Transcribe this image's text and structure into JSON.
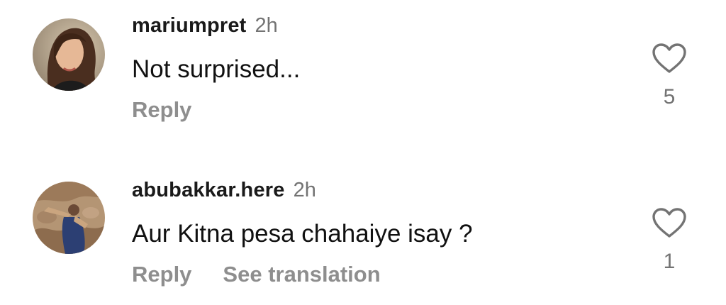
{
  "comments": [
    {
      "username": "mariumpret",
      "time": "2h",
      "text": "Not surprised...",
      "actions": [
        "Reply"
      ],
      "likes": "5",
      "avatar": "profile-photo-woman",
      "like_icon": "heart-outline-icon"
    },
    {
      "username": "abubakkar.here",
      "time": "2h",
      "text": "Aur Kitna pesa chahaiye isay ?",
      "actions": [
        "Reply",
        "See translation"
      ],
      "likes": "1",
      "avatar": "profile-photo-man-on-rocks",
      "like_icon": "heart-outline-icon"
    }
  ],
  "colors": {
    "username": "#1a1a1a",
    "secondary_text": "#737373",
    "action_text": "#8e8e8e",
    "background": "#ffffff"
  }
}
